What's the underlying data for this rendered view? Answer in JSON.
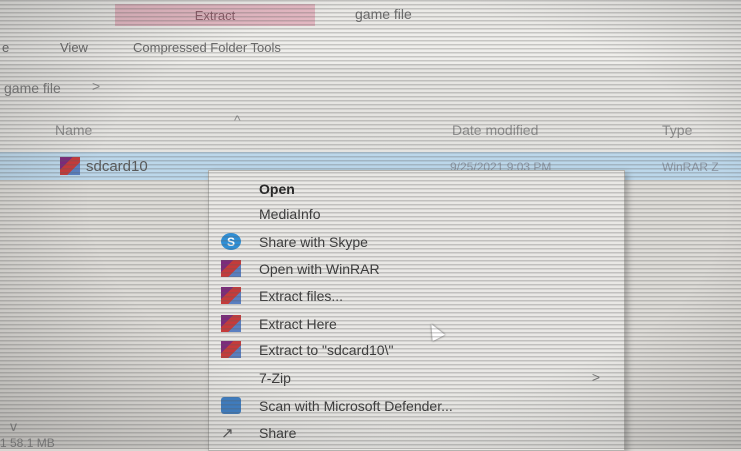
{
  "ribbon": {
    "extract_tab": "Extract",
    "window_title": "game file",
    "menu": [
      "e",
      "View",
      "Compressed Folder Tools"
    ]
  },
  "address": {
    "crumb": "game file",
    "chevron": ">"
  },
  "columns": {
    "name": "Name",
    "sort_caret": "^",
    "date_modified": "Date modified",
    "type": "Type"
  },
  "file": {
    "name": "sdcard10",
    "date": "9/25/2021 9:03 PM",
    "type": "WinRAR Z",
    "icon": "winrar-archive-icon"
  },
  "status": {
    "chevron": "v",
    "text": "1 58.1 MB"
  },
  "context_menu": {
    "items": [
      {
        "label": "Open",
        "bold": true,
        "icon": ""
      },
      {
        "label": "MediaInfo",
        "icon": ""
      },
      {
        "label": "Share with Skype",
        "icon": "skype-icon"
      },
      {
        "label": "Open with WinRAR",
        "icon": "winrar-icon"
      },
      {
        "label": "Extract files...",
        "icon": "winrar-icon"
      },
      {
        "label": "Extract Here",
        "icon": "winrar-icon"
      },
      {
        "label": "Extract to \"sdcard10\\\"",
        "icon": "winrar-icon"
      },
      {
        "label": "7-Zip",
        "icon": "",
        "submenu_arrow": ">"
      },
      {
        "label": "Scan with Microsoft Defender...",
        "icon": "defender-icon"
      },
      {
        "label": "Share",
        "icon": "share-icon"
      }
    ]
  },
  "colors": {
    "selection": "#bcd7ea",
    "extract_tab": "#e2b7c1",
    "menu_bg": "#e9e8e5"
  }
}
